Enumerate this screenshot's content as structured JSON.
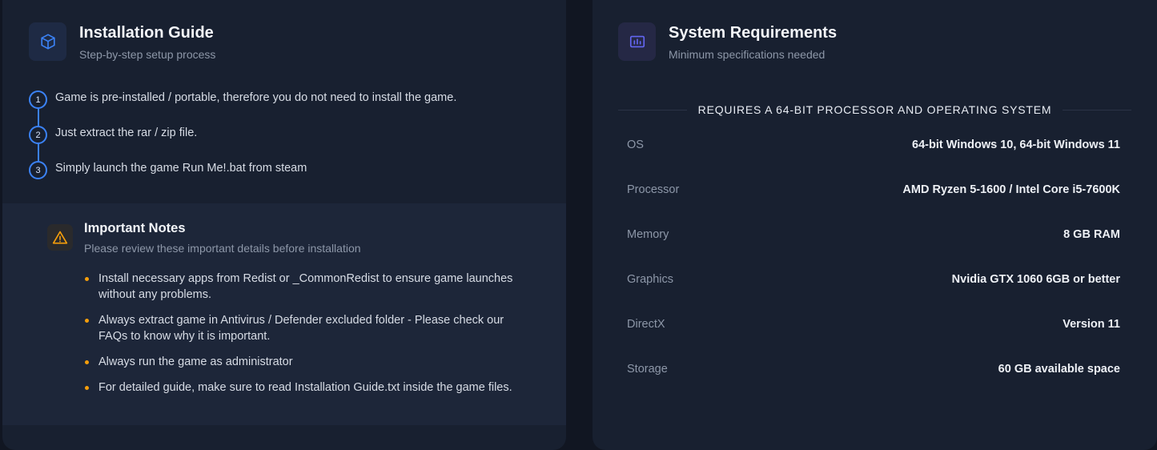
{
  "installation": {
    "title": "Installation Guide",
    "subtitle": "Step-by-step setup process",
    "icon": "cube-icon",
    "accent": "#3b82f6",
    "steps": [
      {
        "num": "1",
        "text": "Game is pre-installed / portable, therefore you do not need to install the game."
      },
      {
        "num": "2",
        "text": "Just extract the rar / zip file."
      },
      {
        "num": "3",
        "text": "Simply launch the game Run Me!.bat from steam"
      }
    ]
  },
  "notes": {
    "title": "Important Notes",
    "subtitle": "Please review these important details before installation",
    "icon": "warning-icon",
    "accent": "#f59e0b",
    "items": [
      "Install necessary apps from Redist or _CommonRedist to ensure game launches without any problems.",
      "Always extract game in Antivirus / Defender excluded folder - Please check our FAQs to know why it is important.",
      "Always run the game as administrator",
      "For detailed guide, make sure to read Installation Guide.txt inside the game files."
    ]
  },
  "requirements": {
    "title": "System Requirements",
    "subtitle": "Minimum specifications needed",
    "icon": "chart-bars-icon",
    "accent": "#6366f1",
    "heading": "REQUIRES A 64-BIT PROCESSOR AND OPERATING SYSTEM",
    "rows": [
      {
        "label": "OS",
        "value": "64-bit Windows 10, 64-bit Windows 11"
      },
      {
        "label": "Processor",
        "value": "AMD Ryzen 5-1600 / Intel Core i5-7600K"
      },
      {
        "label": "Memory",
        "value": "8 GB RAM"
      },
      {
        "label": "Graphics",
        "value": "Nvidia GTX 1060 6GB or better"
      },
      {
        "label": "DirectX",
        "value": "Version 11"
      },
      {
        "label": "Storage",
        "value": "60 GB available space"
      }
    ]
  }
}
